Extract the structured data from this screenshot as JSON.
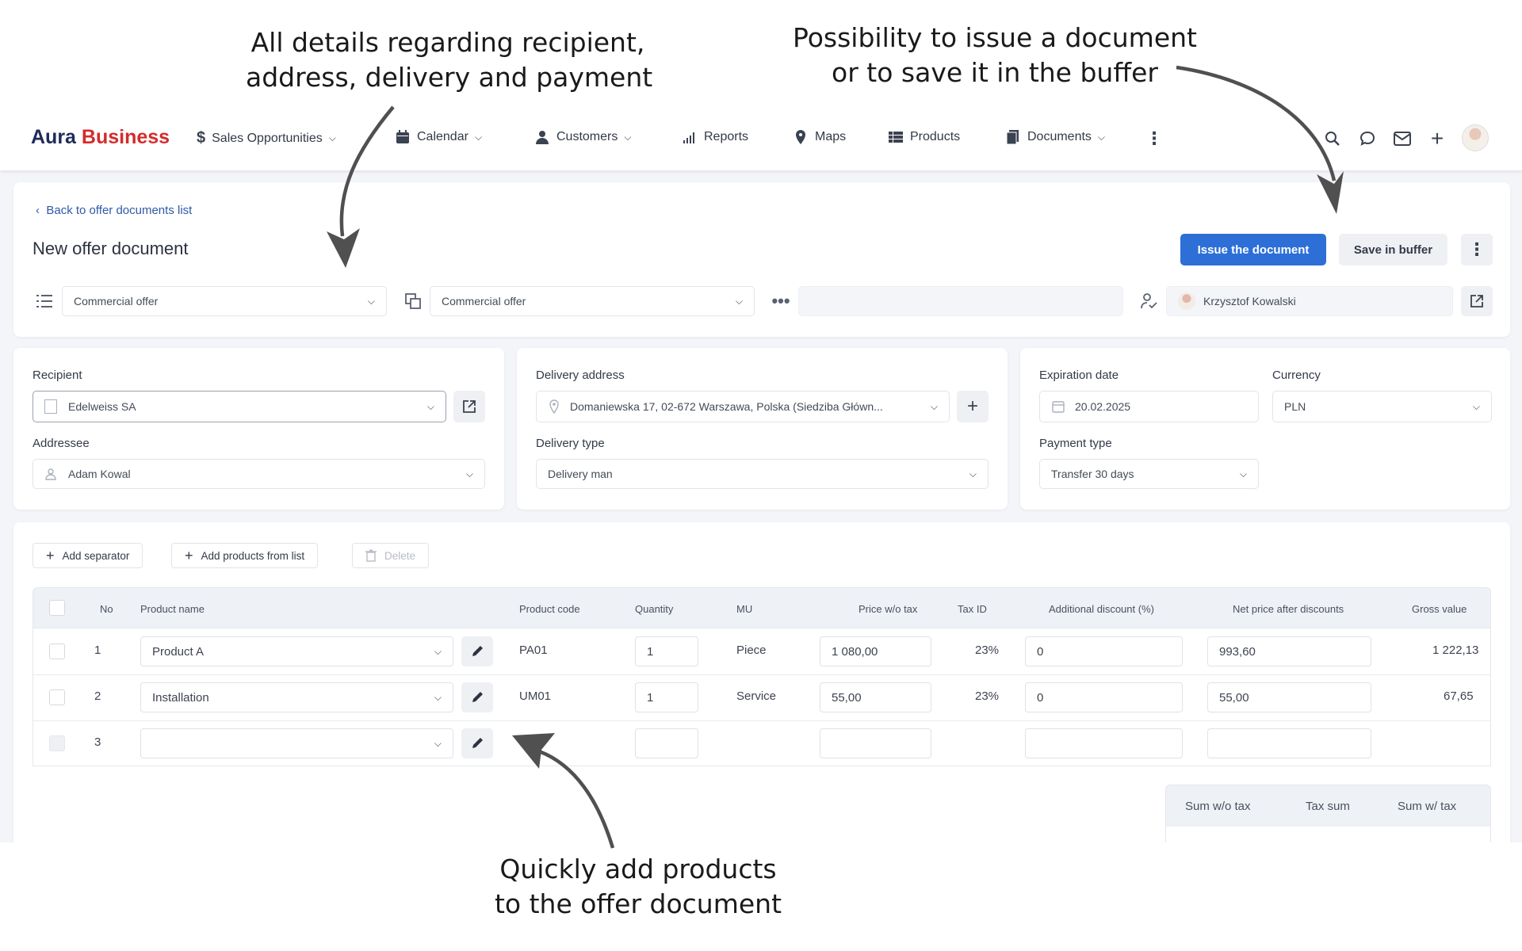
{
  "annotations": {
    "top_left": [
      "All details regarding recipient,",
      "address, delivery and payment"
    ],
    "top_right": [
      "Possibility to issue a document",
      "or to save it in the buffer"
    ],
    "bottom": [
      "Quickly add products",
      "to the offer document"
    ]
  },
  "brand": {
    "part1": "Aura ",
    "part2": "Business"
  },
  "nav": {
    "sales": "Sales Opportunities",
    "calendar": "Calendar",
    "customers": "Customers",
    "reports": "Reports",
    "maps": "Maps",
    "products": "Products",
    "documents": "Documents"
  },
  "header": {
    "back_link": "Back to offer documents list",
    "title": "New offer document",
    "issue_button": "Issue the document",
    "buffer_button": "Save in buffer",
    "doc_type": "Commercial offer",
    "template": "Commercial offer",
    "number": "",
    "owner": "Krzysztof Kowalski"
  },
  "recipient": {
    "recipient_label": "Recipient",
    "recipient_value": "Edelweiss SA",
    "addressee_label": "Addressee",
    "addressee_value": "Adam Kowal"
  },
  "delivery": {
    "address_label": "Delivery address",
    "address_value": "Domaniewska 17, 02-672 Warszawa, Polska (Siedziba Główn...",
    "type_label": "Delivery type",
    "type_value": "Delivery man"
  },
  "payment": {
    "expiration_label": "Expiration date",
    "expiration_value": "20.02.2025",
    "currency_label": "Currency",
    "currency_value": "PLN",
    "payment_type_label": "Payment type",
    "payment_type_value": "Transfer 30 days"
  },
  "toolbar": {
    "add_separator": "Add separator",
    "add_products": "Add products from list",
    "delete": "Delete"
  },
  "table": {
    "headers": {
      "no": "No",
      "name": "Product name",
      "code": "Product code",
      "qty": "Quantity",
      "mu": "MU",
      "price": "Price w/o tax",
      "tax": "Tax ID",
      "discount": "Additional discount (%)",
      "net": "Net price after discounts",
      "gross": "Gross value"
    },
    "rows": [
      {
        "no": "1",
        "name": "Product A",
        "code": "PA01",
        "qty": "1",
        "mu": "Piece",
        "price": "1 080,00",
        "tax": "23%",
        "discount": "0",
        "net": "993,60",
        "gross": "1 222,13"
      },
      {
        "no": "2",
        "name": "Installation",
        "code": "UM01",
        "qty": "1",
        "mu": "Service",
        "price": "55,00",
        "tax": "23%",
        "discount": "0",
        "net": "55,00",
        "gross": "67,65"
      },
      {
        "no": "3",
        "name": "",
        "code": "",
        "qty": "",
        "mu": "",
        "price": "",
        "tax": "",
        "discount": "",
        "net": "",
        "gross": ""
      }
    ]
  },
  "summary": {
    "sum_wo_tax": "Sum w/o tax",
    "tax_sum": "Tax sum",
    "sum_w_tax": "Sum w/ tax"
  },
  "colors": {
    "primary": "#2d6fd6",
    "brand_red": "#d42b2b",
    "brand_navy": "#1f2b5a"
  }
}
